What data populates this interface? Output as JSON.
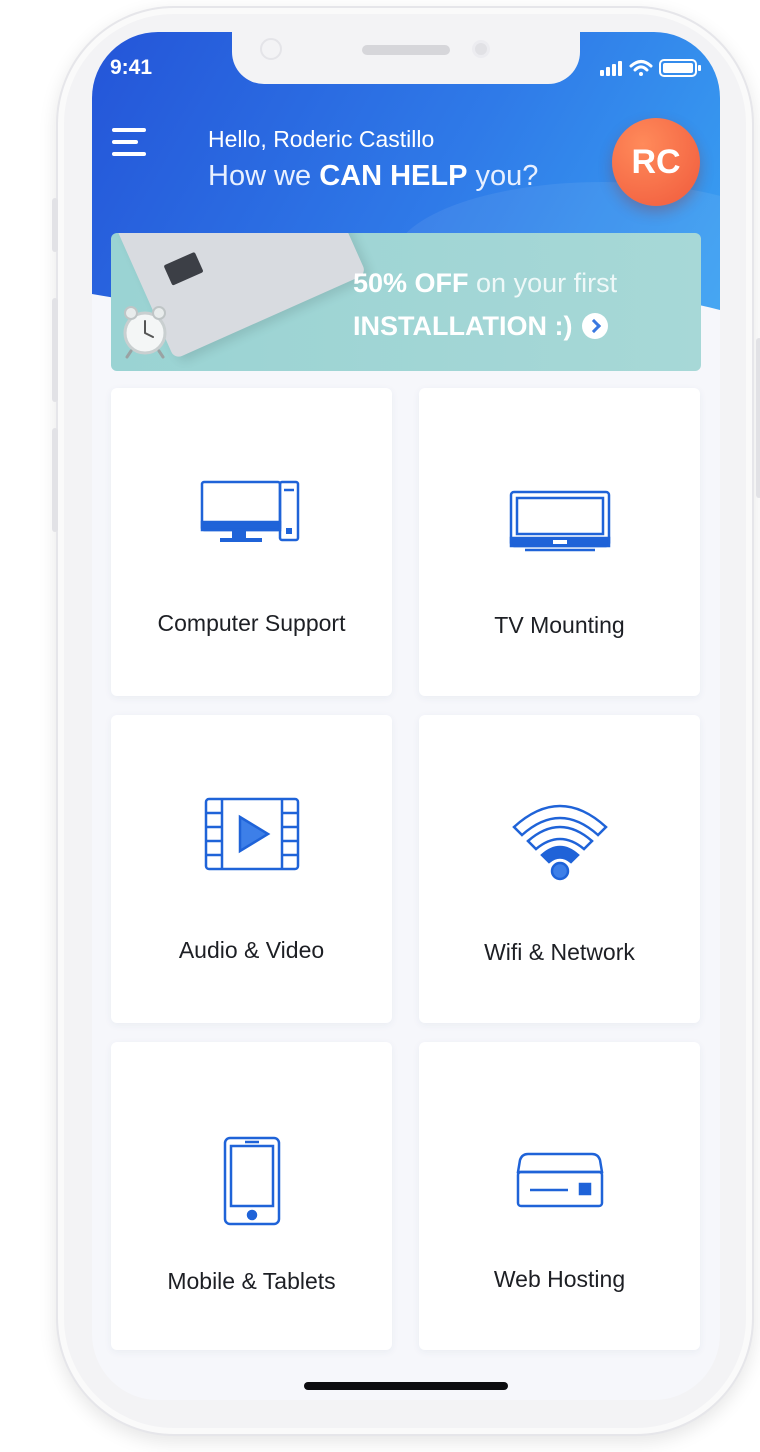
{
  "status": {
    "time": "9:41"
  },
  "header": {
    "greeting": "Hello, Roderic Castillo",
    "help_prefix": "How we ",
    "help_bold": "CAN HELP",
    "help_suffix": " you?",
    "avatar_initials": "RC"
  },
  "banner": {
    "discount": "50% OFF",
    "discount_suffix": " on your first",
    "line2": "INSTALLATION :)"
  },
  "services": [
    {
      "label": "Computer Support",
      "icon": "computer-icon"
    },
    {
      "label": "TV Mounting",
      "icon": "tv-icon"
    },
    {
      "label": "Audio & Video",
      "icon": "video-icon"
    },
    {
      "label": "Wifi & Network",
      "icon": "wifi-icon"
    },
    {
      "label": "Mobile & Tablets",
      "icon": "mobile-icon"
    },
    {
      "label": "Web Hosting",
      "icon": "server-icon"
    }
  ],
  "colors": {
    "primary": "#2f6fe4",
    "icon_blue": "#1f63d8",
    "avatar": "#f26a42",
    "banner_bg": "#9fd5d4"
  }
}
